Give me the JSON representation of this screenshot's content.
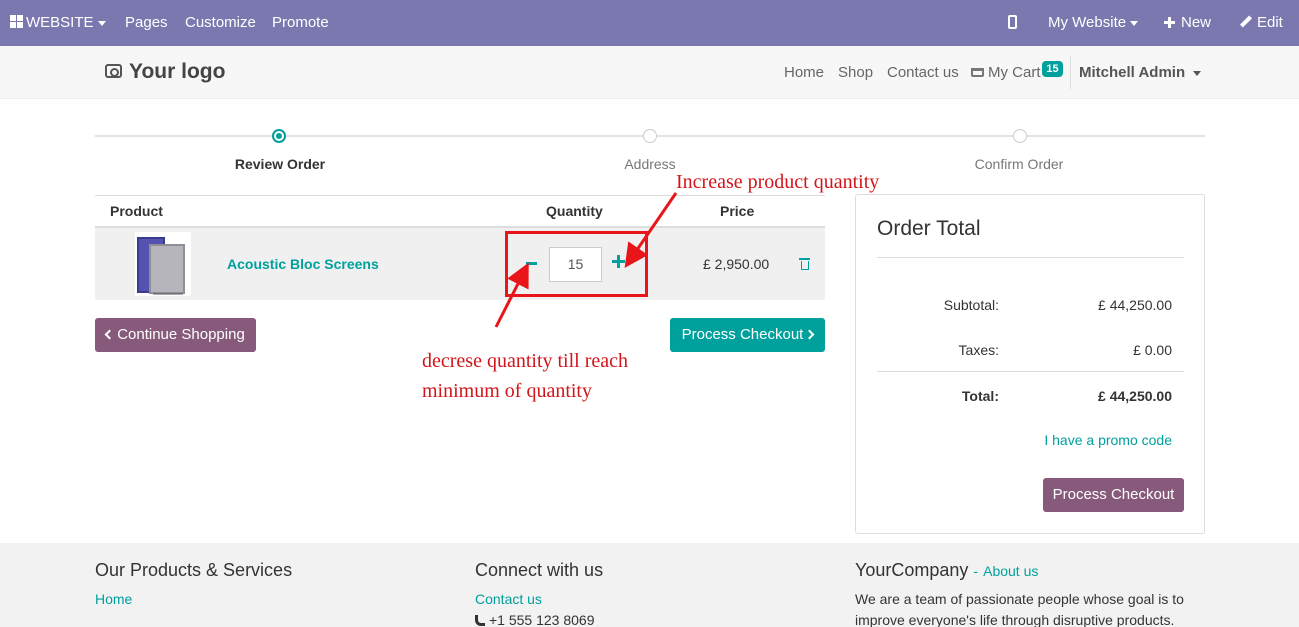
{
  "adminbar": {
    "website_label": "WEBSITE",
    "pages": "Pages",
    "customize": "Customize",
    "promote": "Promote",
    "my_website": "My Website",
    "new": "New",
    "edit": "Edit",
    "background_color": "#7b78b0"
  },
  "header": {
    "logo_text": "Your logo",
    "nav": [
      "Home",
      "Shop",
      "Contact us"
    ],
    "cart_label": "My Cart",
    "cart_count": "15",
    "user": "Mitchell Admin"
  },
  "steps": [
    {
      "label": "Review Order",
      "active": true
    },
    {
      "label": "Address",
      "active": false
    },
    {
      "label": "Confirm Order",
      "active": false
    }
  ],
  "cart": {
    "columns": {
      "product": "Product",
      "quantity": "Quantity",
      "price": "Price"
    },
    "lines": [
      {
        "name": "Acoustic Bloc Screens",
        "quantity": "15",
        "price": "£ 2,950.00"
      }
    ],
    "continue_label": "Continue Shopping",
    "checkout_label": "Process Checkout"
  },
  "order_total": {
    "title": "Order Total",
    "subtotal_label": "Subtotal:",
    "subtotal": "£ 44,250.00",
    "taxes_label": "Taxes:",
    "taxes": "£ 0.00",
    "total_label": "Total:",
    "total": "£ 44,250.00",
    "promo": "I have a promo code",
    "checkout_label": "Process Checkout"
  },
  "annotations": {
    "increase": "Increase product quantity",
    "decrease_line1": "decrese quantity till reach",
    "decrease_line2": "minimum of quantity",
    "color": "#e8161b"
  },
  "footer": {
    "col1_title": "Our Products & Services",
    "col1_link": "Home",
    "col2_title": "Connect with us",
    "col2_link": "Contact us",
    "col2_phone": "+1 555 123 8069",
    "col3_title": "YourCompany",
    "col3_sep": "-",
    "col3_link": "About us",
    "col3_text1": "We are a team of passionate people whose goal is to",
    "col3_text2": "improve everyone's life through disruptive products."
  },
  "colors": {
    "accent": "#00a09d",
    "secondary_button": "#875a7b"
  }
}
